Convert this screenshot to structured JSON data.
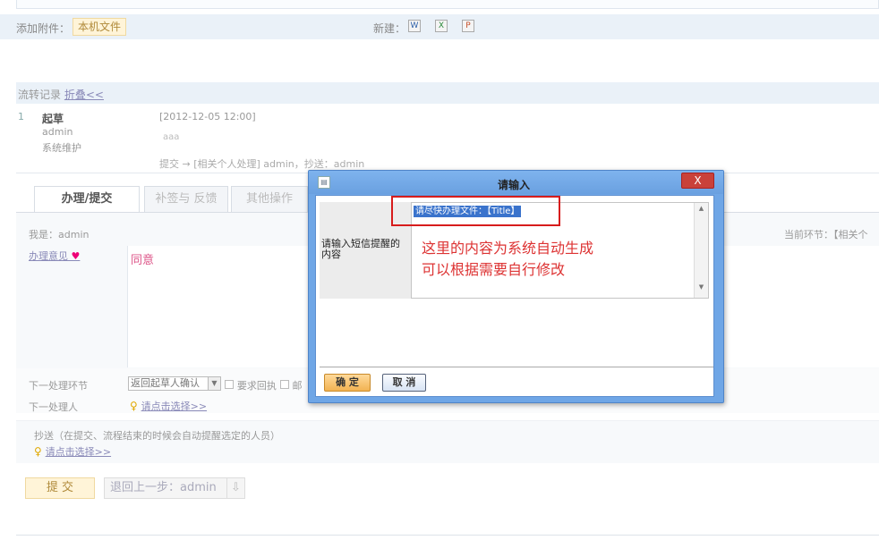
{
  "attachments": {
    "label": "添加附件：",
    "local_file_button": "本机文件",
    "new_label": "新建：",
    "new_icons": [
      "word-icon",
      "excel-icon",
      "ppt-icon"
    ]
  },
  "flow_record": {
    "title": "流转记录",
    "collapse_link": "折叠<<",
    "entries": [
      {
        "num": "1",
        "step": "起草",
        "user": "admin",
        "dept": "系统维护",
        "time": "[2012-12-05 12:00]",
        "note": "aaa",
        "submit_info": "提交 → [相关个人处理] admin，抄送：admin"
      }
    ]
  },
  "tabs": [
    "办理/提交",
    "补签与 反馈",
    "其他操作"
  ],
  "form": {
    "me_label": "我是：admin",
    "current_step": "当前环节：【相关个",
    "opinion_label": "办理意见",
    "opinion_value": "同意",
    "next_step_label": "下一处理环节",
    "next_step_value": "返回起草人确认",
    "require_reply_label": "要求回执",
    "extra_check_label": "邮",
    "next_handler_label": "下一处理人",
    "pick_link": "请点击选择>>",
    "cc_label": "抄送（在提交、流程结束的时候会自动提醒选定的人员）",
    "cc_pick_link": "请点击选择>>",
    "submit_button": "提 交",
    "back_button": "退回上一步：admin"
  },
  "dialog": {
    "title": "请输入",
    "close_label": "X",
    "field_label": "请输入短信提醒的内容",
    "field_value": "请尽快办理文件：【Title】",
    "annotation_line1": "这里的内容为系统自动生成",
    "annotation_line2": "可以根据需要自行修改",
    "ok_button": "确 定",
    "cancel_button": "取 消"
  }
}
